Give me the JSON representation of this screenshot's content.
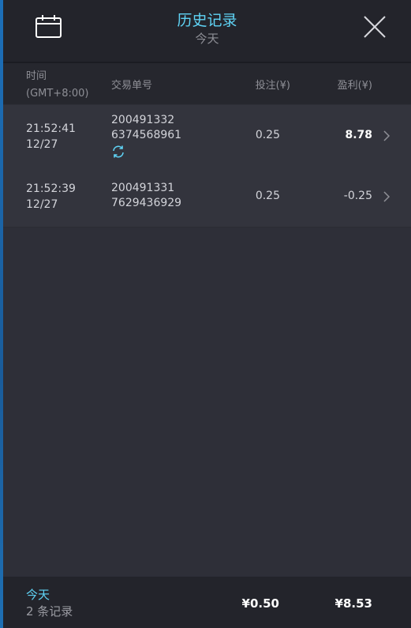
{
  "header": {
    "title": "历史记录",
    "subtitle": "今天",
    "calendar_icon": "calendar-icon",
    "close_icon": "close-icon"
  },
  "table": {
    "columns": {
      "time": "时间",
      "timezone": "(GMT+8:00)",
      "trade_id": "交易单号",
      "stake": "投注(¥)",
      "profit": "盈利(¥)"
    },
    "rows": [
      {
        "time": "21:52:41",
        "date": "12/27",
        "id_line1": "200491332",
        "id_line2": "6374568961",
        "stake": "0.25",
        "profit": "8.78",
        "status_icon": "refresh-icon"
      },
      {
        "time": "21:52:39",
        "date": "12/27",
        "id_line1": "200491331",
        "id_line2": "7629436929",
        "stake": "0.25",
        "profit": "-0.25"
      }
    ]
  },
  "footer": {
    "label": "今天",
    "count": "2 条记录",
    "total_stake": "¥0.50",
    "total_profit": "¥8.53"
  },
  "colors": {
    "accent": "#5fd3f5",
    "background": "#2e2f38",
    "header_bg": "#23242b",
    "row_bg": "#33343d"
  }
}
